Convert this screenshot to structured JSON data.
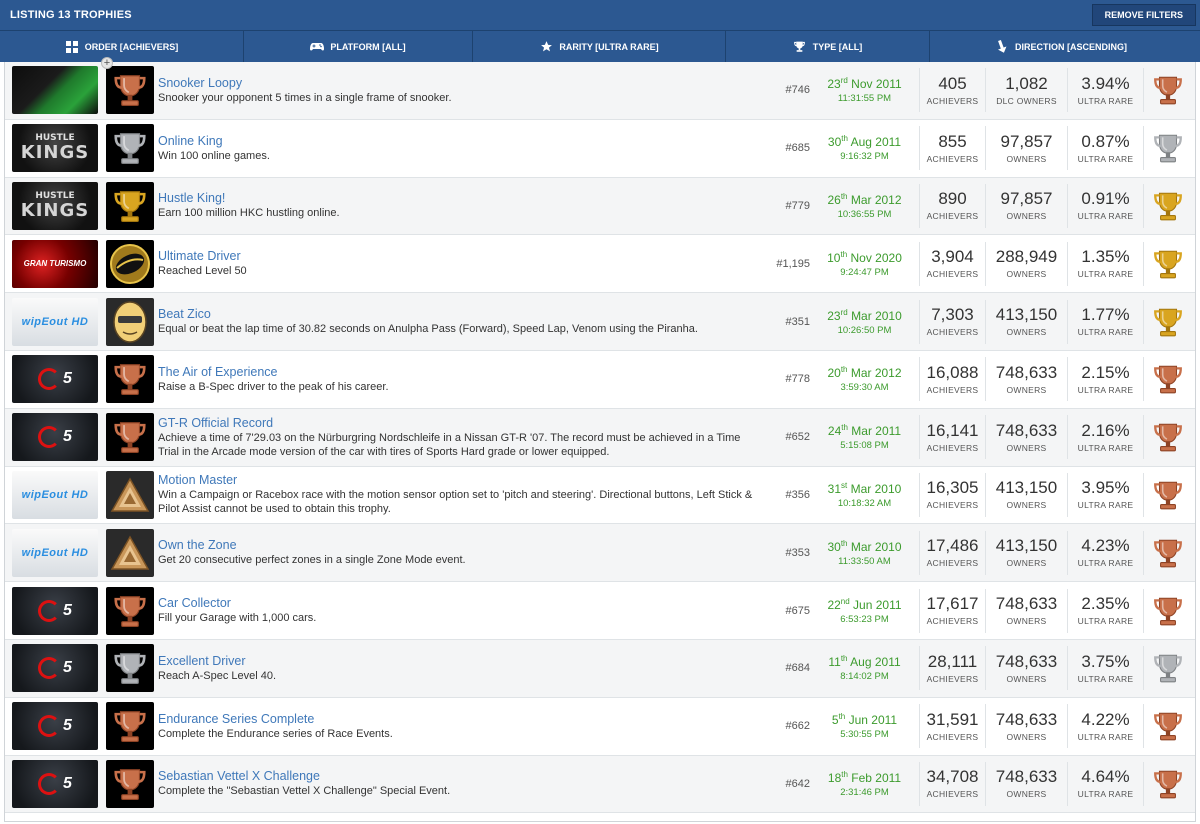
{
  "header": {
    "title": "LISTING 13 TROPHIES",
    "remove_filters": "REMOVE FILTERS"
  },
  "filters": [
    {
      "label": "ORDER [ACHIEVERS]",
      "icon": "grid-icon",
      "width": 243
    },
    {
      "label": "PLATFORM [ALL]",
      "icon": "gamepad-icon",
      "width": 229
    },
    {
      "label": "RARITY [ULTRA RARE]",
      "icon": "star-icon",
      "width": 253
    },
    {
      "label": "TYPE [ALL]",
      "icon": "trophy-icon",
      "width": 204
    },
    {
      "label": "DIRECTION [ASCENDING]",
      "icon": "arrow-down-icon",
      "width": 263
    }
  ],
  "labels": {
    "achievers": "ACHIEVERS",
    "owners": "OWNERS",
    "dlc_owners": "DLC OWNERS",
    "ultra_rare": "ULTRA RARE"
  },
  "colors": {
    "header_bg": "#2c5891",
    "link": "#3f78b9",
    "date": "#3c9b2d",
    "gold": "#d9a520",
    "silver": "#b0b3b7",
    "bronze": "#c8704a"
  },
  "trophies": [
    {
      "game": "snooker",
      "name": "Snooker Loopy",
      "desc": "Snooker your opponent 5 times in a single frame of snooker.",
      "rank": "#746",
      "day": "23",
      "suffix": "rd",
      "monthyear": "Nov 2011",
      "time": "11:31:55 PM",
      "achievers": "405",
      "owners": "1,082",
      "owners_label": "DLC OWNERS",
      "rarity": "3.94%",
      "type": "bronze"
    },
    {
      "game": "hustle",
      "name": "Online King",
      "desc": "Win 100 online games.",
      "rank": "#685",
      "day": "30",
      "suffix": "th",
      "monthyear": "Aug 2011",
      "time": "9:16:32 PM",
      "achievers": "855",
      "owners": "97,857",
      "owners_label": "OWNERS",
      "rarity": "0.87%",
      "type": "silver"
    },
    {
      "game": "hustle",
      "name": "Hustle King!",
      "desc": "Earn 100 million HKC hustling online.",
      "rank": "#779",
      "day": "26",
      "suffix": "th",
      "monthyear": "Mar 2012",
      "time": "10:36:55 PM",
      "achievers": "890",
      "owners": "97,857",
      "owners_label": "OWNERS",
      "rarity": "0.91%",
      "type": "gold"
    },
    {
      "game": "gtsport",
      "name": "Ultimate Driver",
      "desc": "Reached Level 50",
      "rank": "#1,195",
      "day": "10",
      "suffix": "th",
      "monthyear": "Nov 2020",
      "time": "9:24:47 PM",
      "achievers": "3,904",
      "owners": "288,949",
      "owners_label": "OWNERS",
      "rarity": "1.35%",
      "type": "gold"
    },
    {
      "game": "wipeout",
      "name": "Beat Zico",
      "desc": "Equal or beat the lap time of 30.82 seconds on Anulpha Pass (Forward), Speed Lap, Venom using the Piranha.",
      "rank": "#351",
      "day": "23",
      "suffix": "rd",
      "monthyear": "Mar 2010",
      "time": "10:26:50 PM",
      "achievers": "7,303",
      "owners": "413,150",
      "owners_label": "OWNERS",
      "rarity": "1.77%",
      "type": "gold"
    },
    {
      "game": "gt5",
      "name": "The Air of Experience",
      "desc": "Raise a B-Spec driver to the peak of his career.",
      "rank": "#778",
      "day": "20",
      "suffix": "th",
      "monthyear": "Mar 2012",
      "time": "3:59:30 AM",
      "achievers": "16,088",
      "owners": "748,633",
      "owners_label": "OWNERS",
      "rarity": "2.15%",
      "type": "bronze"
    },
    {
      "game": "gt5",
      "name": "GT-R Official Record",
      "desc": "Achieve a time of 7'29.03 on the Nürburgring Nordschleife in a Nissan GT-R '07. The record must be achieved in a Time Trial in the Arcade mode version of the car with tires of Sports Hard grade or lower equipped.",
      "rank": "#652",
      "day": "24",
      "suffix": "th",
      "monthyear": "Mar 2011",
      "time": "5:15:08 PM",
      "achievers": "16,141",
      "owners": "748,633",
      "owners_label": "OWNERS",
      "rarity": "2.16%",
      "type": "bronze"
    },
    {
      "game": "wipeout",
      "name": "Motion Master",
      "desc": "Win a Campaign or Racebox race with the motion sensor option set to 'pitch and steering'. Directional buttons, Left Stick & Pilot Assist cannot be used to obtain this trophy.",
      "rank": "#356",
      "day": "31",
      "suffix": "st",
      "monthyear": "Mar 2010",
      "time": "10:18:32 AM",
      "achievers": "16,305",
      "owners": "413,150",
      "owners_label": "OWNERS",
      "rarity": "3.95%",
      "type": "bronze"
    },
    {
      "game": "wipeout",
      "name": "Own the Zone",
      "desc": "Get 20 consecutive perfect zones in a single Zone Mode event.",
      "rank": "#353",
      "day": "30",
      "suffix": "th",
      "monthyear": "Mar 2010",
      "time": "11:33:50 AM",
      "achievers": "17,486",
      "owners": "413,150",
      "owners_label": "OWNERS",
      "rarity": "4.23%",
      "type": "bronze"
    },
    {
      "game": "gt5",
      "name": "Car Collector",
      "desc": "Fill your Garage with 1,000 cars.",
      "rank": "#675",
      "day": "22",
      "suffix": "nd",
      "monthyear": "Jun 2011",
      "time": "6:53:23 PM",
      "achievers": "17,617",
      "owners": "748,633",
      "owners_label": "OWNERS",
      "rarity": "2.35%",
      "type": "bronze"
    },
    {
      "game": "gt5",
      "name": "Excellent Driver",
      "desc": "Reach A-Spec Level 40.",
      "rank": "#684",
      "day": "11",
      "suffix": "th",
      "monthyear": "Aug 2011",
      "time": "8:14:02 PM",
      "achievers": "28,111",
      "owners": "748,633",
      "owners_label": "OWNERS",
      "rarity": "3.75%",
      "type": "silver"
    },
    {
      "game": "gt5",
      "name": "Endurance Series Complete",
      "desc": "Complete the Endurance series of Race Events.",
      "rank": "#662",
      "day": "5",
      "suffix": "th",
      "monthyear": "Jun 2011",
      "time": "5:30:55 PM",
      "achievers": "31,591",
      "owners": "748,633",
      "owners_label": "OWNERS",
      "rarity": "4.22%",
      "type": "bronze"
    },
    {
      "game": "gt5",
      "name": "Sebastian Vettel X Challenge",
      "desc": "Complete the \"Sebastian Vettel X Challenge\" Special Event.",
      "rank": "#642",
      "day": "18",
      "suffix": "th",
      "monthyear": "Feb 2011",
      "time": "2:31:46 PM",
      "achievers": "34,708",
      "owners": "748,633",
      "owners_label": "OWNERS",
      "rarity": "4.64%",
      "type": "bronze"
    }
  ]
}
